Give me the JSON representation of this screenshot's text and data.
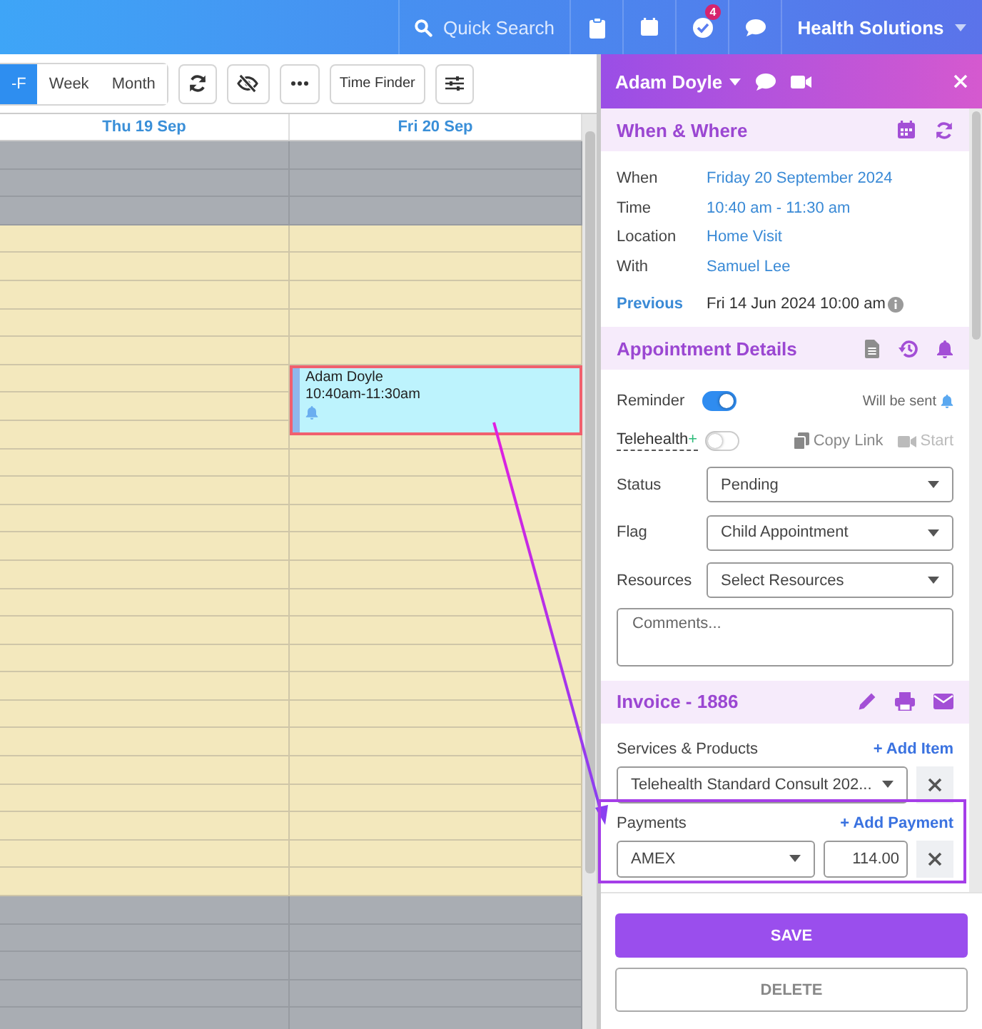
{
  "topbar": {
    "search_placeholder": "Quick Search",
    "notification_badge": "4",
    "organization": "Health Solutions"
  },
  "toolbar": {
    "views": [
      {
        "label": "-F",
        "selected": true
      },
      {
        "label": "Week",
        "selected": false
      },
      {
        "label": "Month",
        "selected": false
      }
    ],
    "time_finder": "Time Finder"
  },
  "calendar": {
    "columns": [
      "Thu 19 Sep",
      "Fri 20 Sep"
    ],
    "rows": [
      {
        "available": false
      },
      {
        "available": false
      },
      {
        "available": false
      },
      {
        "available": true
      },
      {
        "available": true
      },
      {
        "available": true
      },
      {
        "available": true
      },
      {
        "available": true
      },
      {
        "available": true
      },
      {
        "available": true
      },
      {
        "available": true
      },
      {
        "available": true
      },
      {
        "available": true
      },
      {
        "available": true
      },
      {
        "available": true
      },
      {
        "available": true
      },
      {
        "available": true
      },
      {
        "available": true
      },
      {
        "available": true
      },
      {
        "available": true
      },
      {
        "available": true
      },
      {
        "available": true
      },
      {
        "available": true
      },
      {
        "available": true
      },
      {
        "available": true
      },
      {
        "available": true
      },
      {
        "available": true
      },
      {
        "available": false
      },
      {
        "available": false
      },
      {
        "available": false
      },
      {
        "available": false
      },
      {
        "available": false
      }
    ],
    "event": {
      "title": "Adam Doyle",
      "time": "10:40am-11:30am",
      "reminder": true
    }
  },
  "panel": {
    "client": "Adam Doyle",
    "when_where": {
      "title": "When & Where",
      "fields": [
        {
          "label": "When",
          "value": "Friday 20 September 2024"
        },
        {
          "label": "Time",
          "value": "10:40 am - 11:30 am"
        },
        {
          "label": "Location",
          "value": "Home Visit"
        },
        {
          "label": "With",
          "value": "Samuel Lee"
        }
      ],
      "previous": {
        "label": "Previous",
        "value": "Fri 14 Jun 2024 10:00 am"
      }
    },
    "details": {
      "title": "Appointment Details",
      "reminder": {
        "label": "Reminder",
        "on": true,
        "note": "Will be sent"
      },
      "telehealth": {
        "label": "Telehealth",
        "plus": "+",
        "on": false,
        "copy_link": "Copy Link",
        "start": "Start"
      },
      "selects": [
        {
          "label": "Status",
          "value": "Pending"
        },
        {
          "label": "Flag",
          "value": "Child Appointment"
        },
        {
          "label": "Resources",
          "value": "Select Resources"
        }
      ],
      "comments_placeholder": "Comments..."
    },
    "invoice": {
      "title": "Invoice - 1886",
      "services_label": "Services & Products",
      "add_item": "+ Add Item",
      "service": "Telehealth Standard Consult 202...",
      "payments_label": "Payments",
      "add_payment": "+ Add Payment",
      "payment_method": "AMEX",
      "payment_amount": "114.00"
    },
    "save": "SAVE",
    "delete": "DELETE"
  }
}
